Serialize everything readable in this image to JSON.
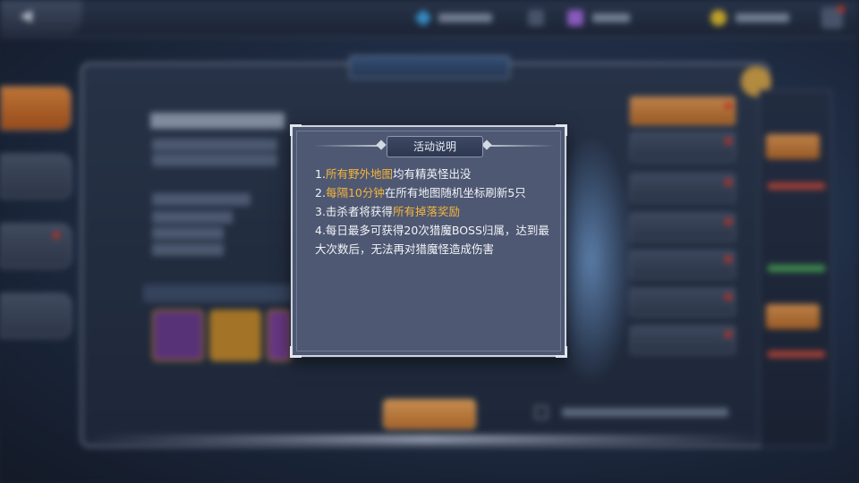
{
  "modal": {
    "title": "活动说明",
    "lines": [
      {
        "prefix": "1.",
        "highlight": "所有野外地图",
        "rest": "均有精英怪出没"
      },
      {
        "prefix": "2.",
        "highlight": "每隔10分钟",
        "rest": "在所有地图随机坐标刷新5只"
      },
      {
        "prefix": "3.击杀者将获得",
        "highlight": "所有掉落奖励",
        "rest": ""
      },
      {
        "prefix": "4.每日最多可获得20次猎魔BOSS归属，达到最大次数后，无法再对猎魔怪造成伤害",
        "highlight": "",
        "rest": ""
      }
    ]
  },
  "colors": {
    "highlight": "#f5b53c",
    "body_text": "#f2f4f8",
    "modal_bg": "#4e5872",
    "accent_orange": "#e49a52"
  },
  "icons": {
    "back": "arrow-left-icon",
    "currency_1": "diamond-icon",
    "currency_2": "purple-crystal-icon",
    "currency_3": "gold-coin-icon"
  }
}
